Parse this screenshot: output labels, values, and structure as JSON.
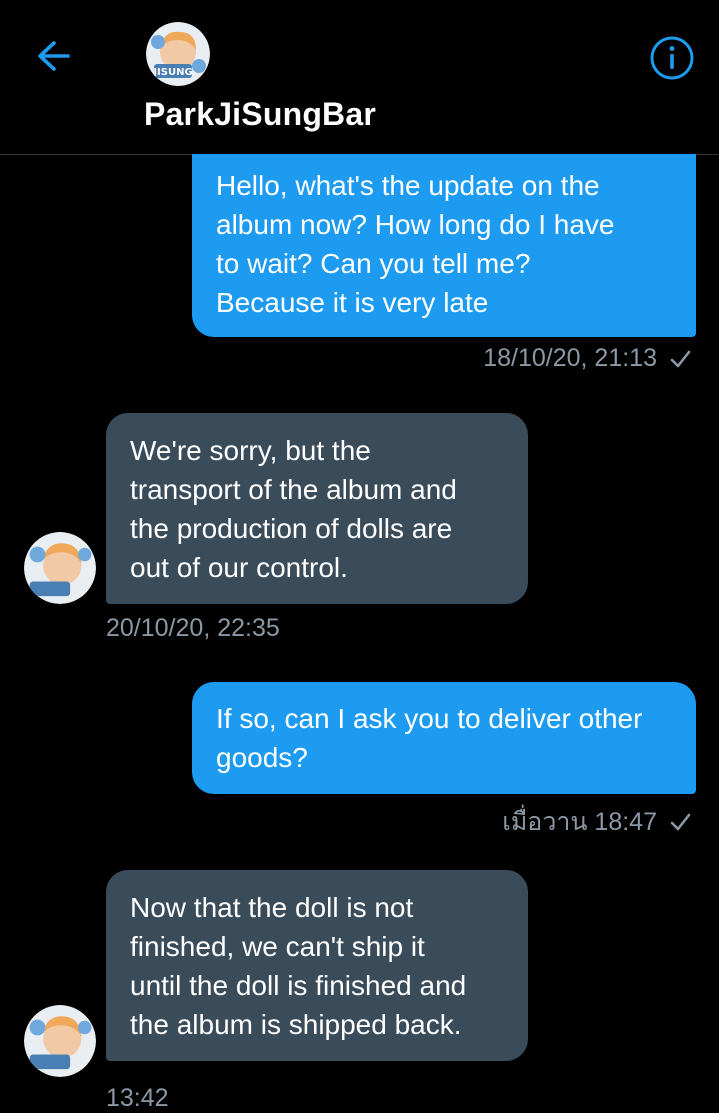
{
  "header": {
    "name": "ParkJiSungBar",
    "avatar_text": "JISUNG",
    "back_icon": "arrow-left-icon",
    "info_icon": "info-icon"
  },
  "colors": {
    "accent": "#1d9bf0",
    "received_bubble": "#3a4b59",
    "meta_text": "#8b98a5",
    "background": "#000000"
  },
  "messages": [
    {
      "direction": "sent",
      "lines": [
        "Hello, what's the update on the",
        "album now?  How long do I have",
        "to wait? Can you tell me?",
        "Because it is very late"
      ],
      "timestamp": "18/10/20, 21:13"
    },
    {
      "direction": "received",
      "lines": [
        "We're sorry, but the",
        "transport of the album and",
        "the production of dolls are",
        "out of our control."
      ],
      "timestamp": "20/10/20, 22:35"
    },
    {
      "direction": "sent",
      "lines": [
        "If so, can I ask you to deliver other",
        "goods?"
      ],
      "timestamp": "เมื่อวาน 18:47"
    },
    {
      "direction": "received",
      "lines": [
        "Now that the doll is not",
        "finished, we can't ship it",
        "until the doll is finished and",
        "the album is shipped back."
      ],
      "timestamp": "13:42"
    }
  ]
}
